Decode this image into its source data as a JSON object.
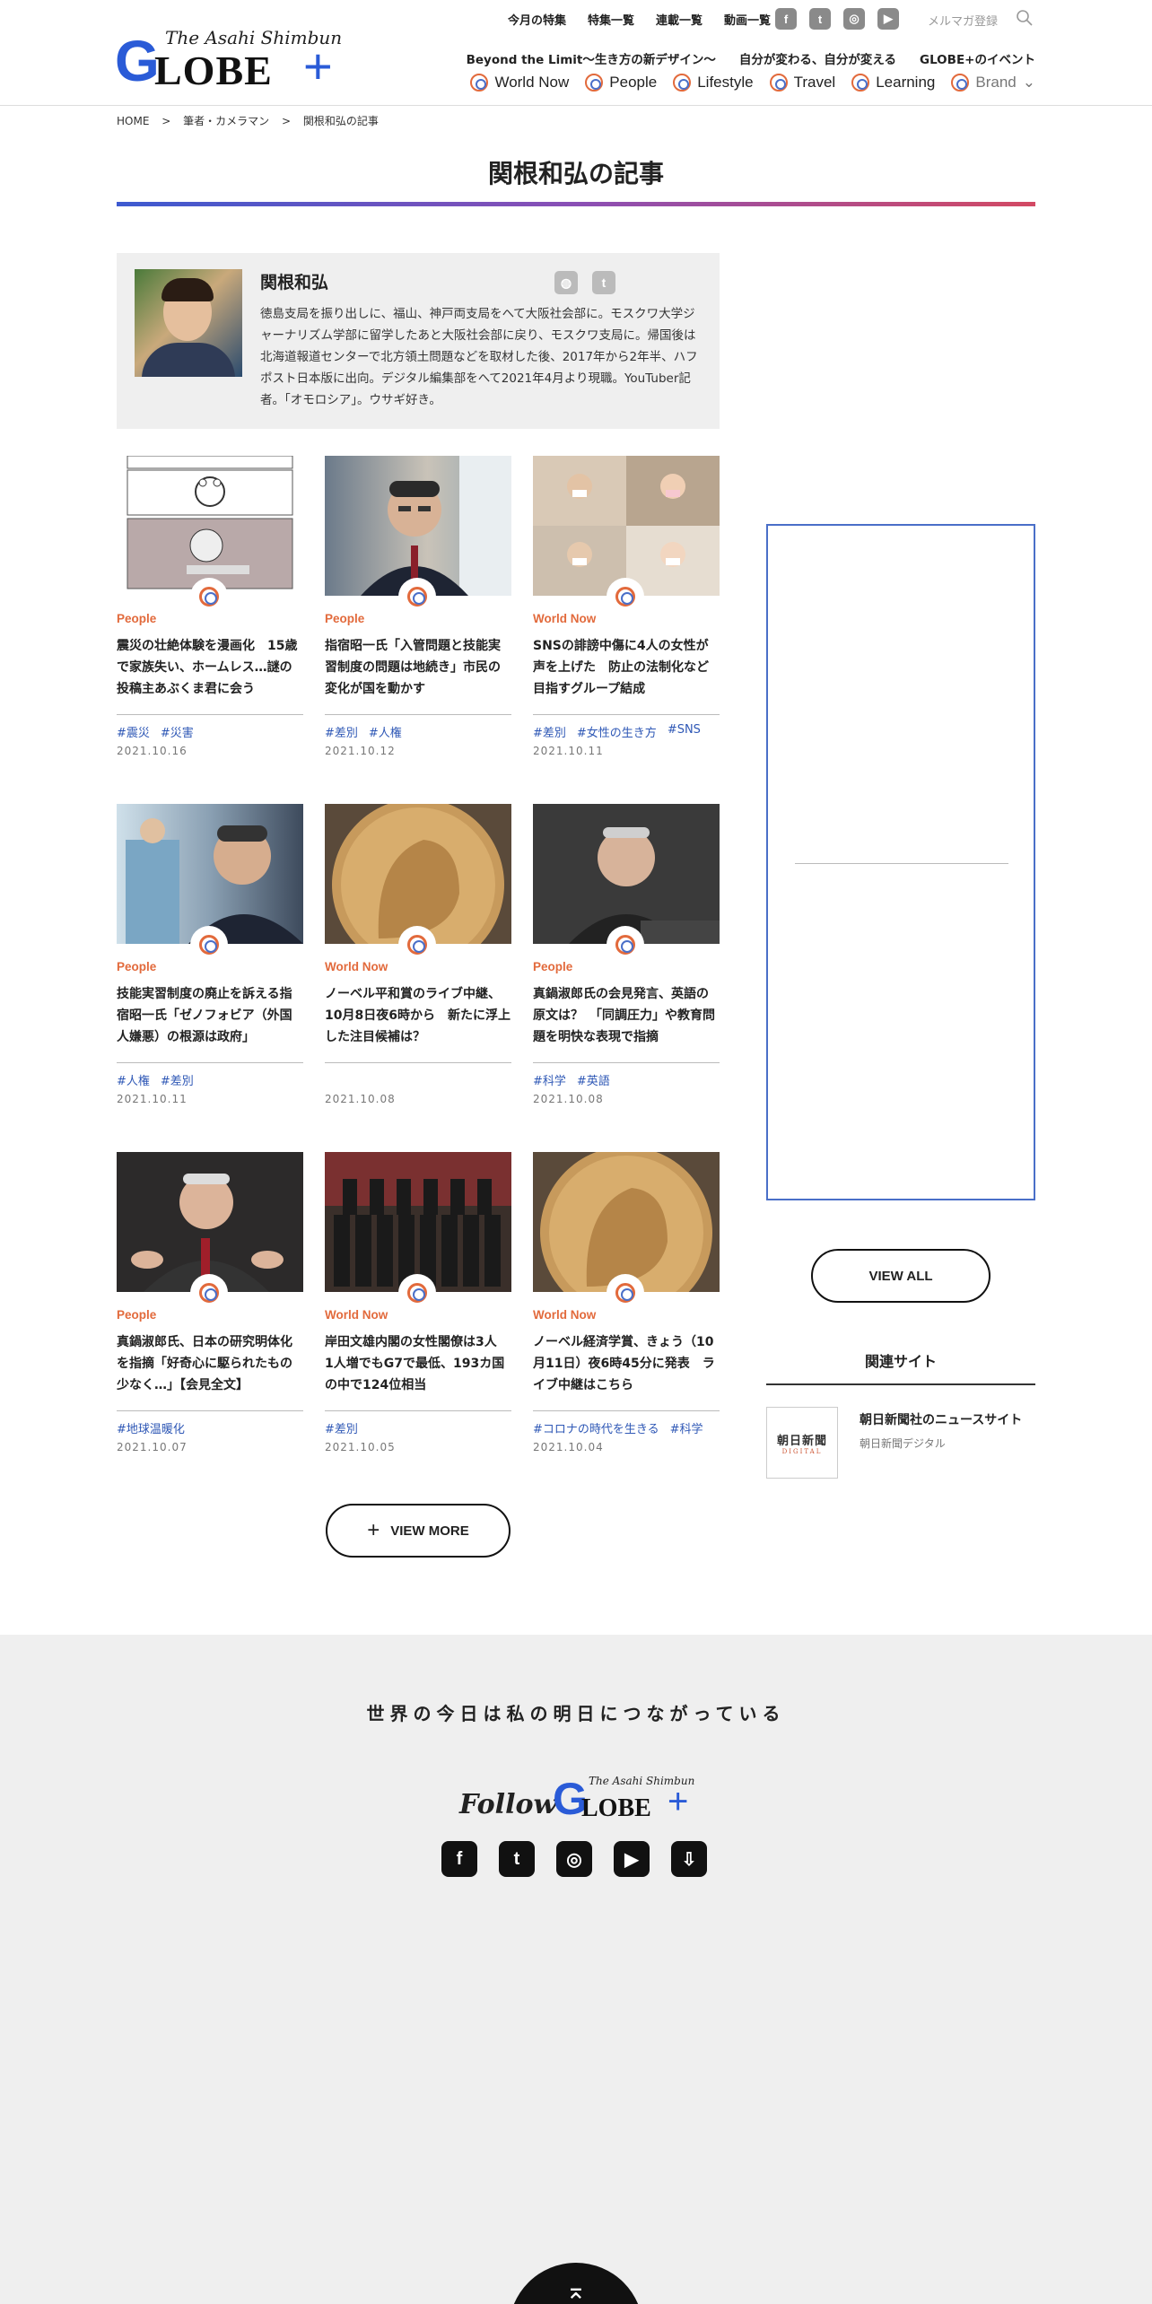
{
  "header": {
    "logo_tagline": "The Asahi Shimbun",
    "logo_g": "G",
    "logo_rest": "LOBE",
    "logo_plus": "+",
    "topnav": [
      "今月の特集",
      "特集一覧",
      "連載一覧",
      "動画一覧"
    ],
    "social": [
      {
        "icon": "facebook-icon",
        "glyph": "f"
      },
      {
        "icon": "twitter-icon",
        "glyph": "t"
      },
      {
        "icon": "instagram-icon",
        "glyph": "◎"
      },
      {
        "icon": "youtube-icon",
        "glyph": "▶"
      }
    ],
    "mailmag": "メルマガ登録",
    "subnav": [
      "Beyond the Limit～生き方の新デザイン～",
      "自分が変わる、自分が変える",
      "GLOBE+のイベント"
    ],
    "categories": [
      "World Now",
      "People",
      "Lifestyle",
      "Travel",
      "Learning",
      "Brand"
    ],
    "brand_caret": "⌄"
  },
  "breadcrumb": [
    "HOME",
    ">",
    "筆者・カメラマン",
    ">",
    "関根和弘の記事"
  ],
  "page_title": "関根和弘の記事",
  "profile": {
    "name": "関根和弘",
    "bio": "徳島支局を振り出しに、福山、神戸両支局をへて大阪社会部に。モスクワ大学ジャーナリズム学部に留学したあと大阪社会部に戻り、モスクワ支局に。帰国後は北海道報道センターで北方領土問題などを取材した後、2017年から2年半、ハフポスト日本版に出向。デジタル編集部をへて2021年4月より現職。YouTuber記者。「オモロシア」。ウサギ好き。",
    "icons": [
      {
        "icon": "website-icon",
        "glyph": "◍"
      },
      {
        "icon": "twitter-icon",
        "glyph": "t"
      }
    ]
  },
  "articles": [
    {
      "category": "People",
      "title": "震災の壮絶体験を漫画化　15歳で家族失い、ホームレス…謎の投稿主あぶくま君に会う",
      "tags": [
        "#震災",
        "#災害"
      ],
      "date": "2021.10.16"
    },
    {
      "category": "People",
      "title": "指宿昭一氏「入管問題と技能実習制度の問題は地続き」市民の変化が国を動かす",
      "tags": [
        "#差別",
        "#人権"
      ],
      "date": "2021.10.12"
    },
    {
      "category": "World Now",
      "title": "SNSの誹謗中傷に4人の女性が声を上げた　防止の法制化など目指すグループ結成",
      "tags": [
        "#差別",
        "#女性の生き方",
        "#SNS"
      ],
      "date": "2021.10.11"
    },
    {
      "category": "People",
      "title": "技能実習制度の廃止を訴える指宿昭一氏「ゼノフォビア（外国人嫌悪）の根源は政府」",
      "tags": [
        "#人権",
        "#差別"
      ],
      "date": "2021.10.11"
    },
    {
      "category": "World Now",
      "title": "ノーベル平和賞のライブ中継、10月8日夜6時から　新たに浮上した注目候補は？",
      "tags": [],
      "date": "2021.10.08"
    },
    {
      "category": "People",
      "title": "真鍋淑郎氏の会見発言、英語の原文は？　「同調圧力」や教育問題を明快な表現で指摘",
      "tags": [
        "#科学",
        "#英語"
      ],
      "date": "2021.10.08"
    },
    {
      "category": "People",
      "title": "真鍋淑郎氏、日本の研究明体化を指摘「好奇心に駆られたもの少なく…」【会見全文】",
      "tags": [
        "#地球温暖化"
      ],
      "date": "2021.10.07"
    },
    {
      "category": "World Now",
      "title": "岸田文雄内閣の女性閣僚は3人　1人増でもG7で最低、193カ国の中で124位相当",
      "tags": [
        "#差別"
      ],
      "date": "2021.10.05"
    },
    {
      "category": "World Now",
      "title": "ノーベル経済学賞、きょう（10月11日）夜6時45分に発表　ライブ中継はこちら",
      "tags": [
        "#コロナの時代を生きる",
        "#科学"
      ],
      "date": "2021.10.04"
    }
  ],
  "view_more": "VIEW MORE",
  "view_more_icon": "+",
  "sidebar": {
    "view_all": "VIEW ALL",
    "related_heading": "関連サイト",
    "related": {
      "logo_main": "朝日新聞",
      "logo_sub": "DIGITAL",
      "title": "朝日新聞社のニュースサイト",
      "subtitle": "朝日新聞デジタル"
    }
  },
  "footer": {
    "tagline": "世界の今日は私の明日につながっている",
    "follow": "Follow",
    "logo_tagline": "The Asahi Shimbun",
    "logo_g": "G",
    "logo_rest": "LOBE",
    "logo_plus": "+",
    "social": [
      {
        "icon": "facebook-icon",
        "glyph": "f"
      },
      {
        "icon": "twitter-icon",
        "glyph": "t"
      },
      {
        "icon": "instagram-icon",
        "glyph": "◎"
      },
      {
        "icon": "youtube-icon",
        "glyph": "▶"
      },
      {
        "icon": "download-icon",
        "glyph": "⇩"
      }
    ],
    "back_to_top": "⌅"
  },
  "colors": {
    "accent_blue": "#2a5bd7",
    "category_orange": "#e26a3c",
    "tag_blue": "#2f58b6"
  }
}
